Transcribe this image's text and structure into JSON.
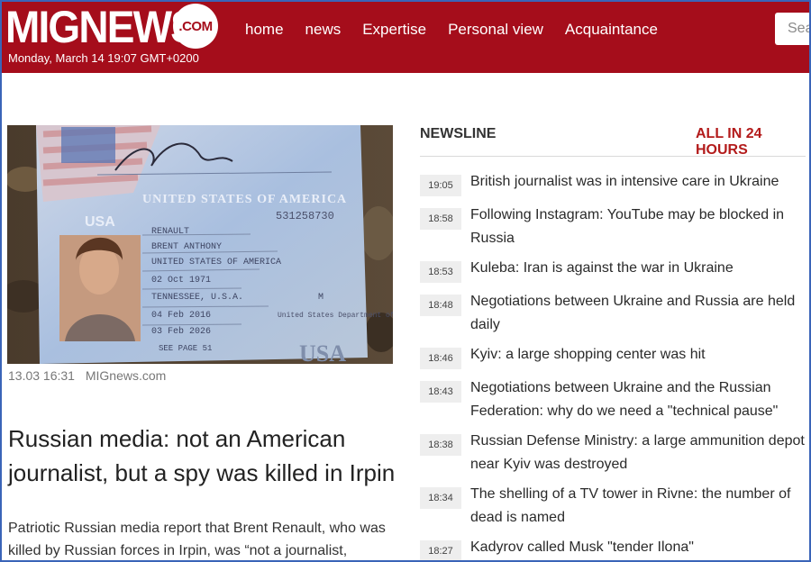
{
  "header": {
    "logo": "MIGNEWS",
    "logo_domain": ".COM",
    "date": "Monday, March 14 19:07 GMT+0200",
    "nav": [
      "home",
      "news",
      "Expertise",
      "Personal view",
      "Acquaintance"
    ],
    "search_placeholder": "Sea"
  },
  "article": {
    "photo_alt": "passport",
    "date": "13.03 16:31",
    "source": "MIGnews.com",
    "headline": "Russian media: not an American journalist, but a spy was killed in Irpin",
    "lead": "Patriotic Russian media report that Brent Renault, who was killed by Russian forces in Irpin, was “not a journalist,"
  },
  "newsline": {
    "title": "NEWSLINE",
    "all_link": "ALL IN 24 HOURS",
    "items": [
      {
        "time": "19:05",
        "text": "British journalist was in intensive care in Ukraine"
      },
      {
        "time": "18:58",
        "text": "Following Instagram: YouTube may be blocked in Russia"
      },
      {
        "time": "18:53",
        "text": "Kuleba: Iran is against the war in Ukraine"
      },
      {
        "time": "18:48",
        "text": "Negotiations between Ukraine and Russia are held daily"
      },
      {
        "time": "18:46",
        "text": "Kyiv: a large shopping center was hit"
      },
      {
        "time": "18:43",
        "text": "Negotiations between Ukraine and the Russian Federation: why do we need a \"technical pause\""
      },
      {
        "time": "18:38",
        "text": "Russian Defense Ministry: a large ammunition depot near Kyiv was destroyed"
      },
      {
        "time": "18:34",
        "text": "The shelling of a TV tower in Rivne: the number of dead is named"
      },
      {
        "time": "18:27",
        "text": "Kadyrov called Musk \"tender Ilona\""
      }
    ]
  },
  "passport": {
    "country_header": "UNITED STATES OF AMERICA",
    "type_line": "USA",
    "number": "531258730",
    "surname": "RENAULT",
    "given_names": "BRENT ANTHONY",
    "nationality": "UNITED STATES OF AMERICA",
    "dob": "02 Oct 1971",
    "pob": "TENNESSEE, U.S.A.",
    "sex": "M",
    "issue": "04 Feb 2016",
    "expiry": "03 Feb 2026",
    "authority": "United States Department of State",
    "endorsement": "SEE PAGE 51",
    "country_mark": "USA"
  }
}
